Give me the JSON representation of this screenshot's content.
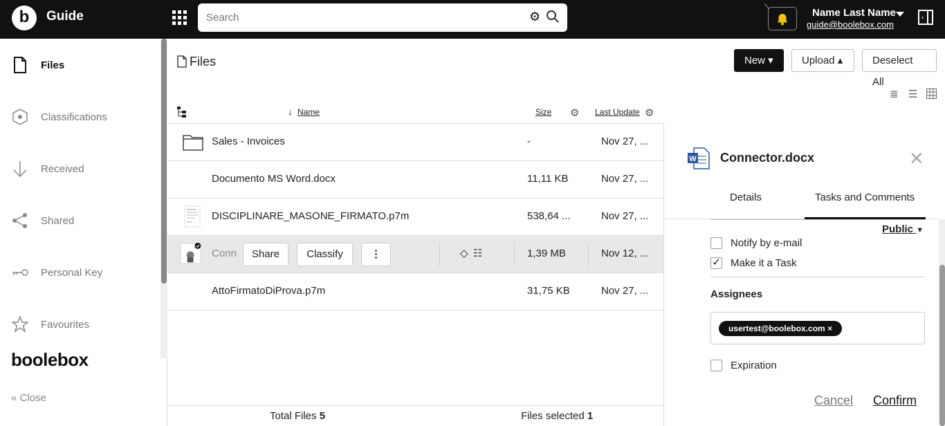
{
  "app": {
    "logo_letter": "b",
    "title": "Guide"
  },
  "search": {
    "placeholder": "Search"
  },
  "user": {
    "name": "Name Last Name",
    "email": "guide@boolebox.com"
  },
  "sidebar": {
    "items": [
      {
        "label": "Files"
      },
      {
        "label": "Classifications"
      },
      {
        "label": "Received"
      },
      {
        "label": "Shared"
      },
      {
        "label": "Personal Key"
      },
      {
        "label": "Favourites"
      }
    ],
    "brand": "boolebox",
    "close_label": "Close"
  },
  "main": {
    "breadcrumb": "Files",
    "buttons": {
      "new": "New",
      "upload": "Upload",
      "deselect": "Deselect All"
    },
    "columns": {
      "name": "Name",
      "size": "Size",
      "last_update": "Last Update"
    },
    "rows": [
      {
        "name": "Sales - Invoices",
        "size": "-",
        "date": "Nov 27, ..."
      },
      {
        "name": "Documento MS Word.docx",
        "size": "11,11 KB",
        "date": "Nov 27, ..."
      },
      {
        "name": "DISCIPLINARE_MASONE_FIRMATO.p7m",
        "size": "538,64 ...",
        "date": "Nov 27, ..."
      },
      {
        "name": "Conn",
        "size": "1,39 MB",
        "date": "Nov 12, ..."
      },
      {
        "name": "AttoFirmatoDiProva.p7m",
        "size": "31,75 KB",
        "date": "Nov 27, ..."
      }
    ],
    "row_actions": {
      "share": "Share",
      "classify": "Classify"
    },
    "footer": {
      "total_label": "Total Files",
      "total_value": "5",
      "selected_label": "Files selected",
      "selected_value": "1"
    }
  },
  "detail": {
    "title": "Connector.docx",
    "tabs": [
      "Details",
      "Tasks and Comments"
    ],
    "visibility": "Public",
    "notify_label": "Notify by e-mail",
    "task_label": "Make it a Task",
    "assignees_label": "Assignees",
    "assignee_chip": "usertest@boolebox.com",
    "expiration_label": "Expiration",
    "cancel": "Cancel",
    "confirm": "Confirm"
  }
}
